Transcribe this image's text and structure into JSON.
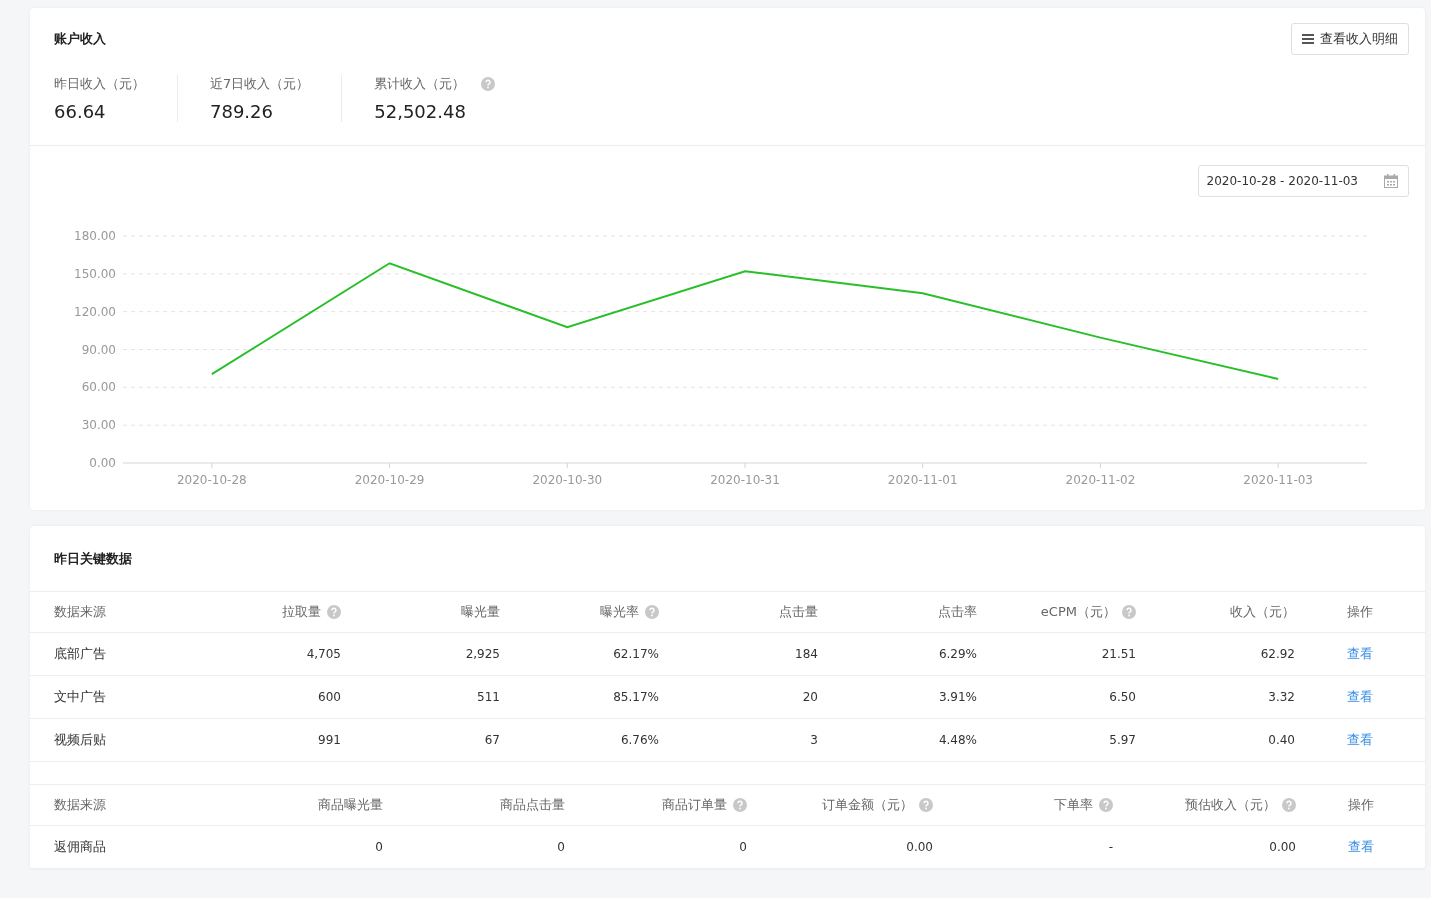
{
  "income_card": {
    "title": "账户收入",
    "detail_button": "查看收入明细",
    "stats": [
      {
        "label": "昨日收入（元）",
        "value": "66.64",
        "help": false
      },
      {
        "label": "近7日收入（元）",
        "value": "789.26",
        "help": false
      },
      {
        "label": "累计收入（元）",
        "value": "52,502.48",
        "help": true
      }
    ],
    "date_range": "2020-10-28 - 2020-11-03",
    "chart_data": {
      "type": "line",
      "categories": [
        "2020-10-28",
        "2020-10-29",
        "2020-10-30",
        "2020-10-31",
        "2020-11-01",
        "2020-11-02",
        "2020-11-03"
      ],
      "series": [
        {
          "color": "#29bf29",
          "values": [
            70.5,
            158.4,
            107.6,
            152.1,
            134.6,
            99.4,
            66.6
          ]
        }
      ],
      "grid": true,
      "ylim": [
        0,
        180
      ],
      "yticks": [
        {
          "value": 0,
          "label": "0.00"
        },
        {
          "value": 30,
          "label": "30.00"
        },
        {
          "value": 60,
          "label": "60.00"
        },
        {
          "value": 90,
          "label": "90.00"
        },
        {
          "value": 120,
          "label": "120.00"
        },
        {
          "value": 150,
          "label": "150.00"
        },
        {
          "value": 180,
          "label": "180.00"
        }
      ]
    }
  },
  "key_data_card": {
    "title": "昨日关键数据",
    "ad_table": {
      "columns": [
        {
          "label": "数据来源",
          "help": false
        },
        {
          "label": "拉取量",
          "help": true
        },
        {
          "label": "曝光量",
          "help": false
        },
        {
          "label": "曝光率",
          "help": true
        },
        {
          "label": "点击量",
          "help": false
        },
        {
          "label": "点击率",
          "help": false
        },
        {
          "label": "eCPM（元）",
          "help": true
        },
        {
          "label": "收入（元）",
          "help": false
        },
        {
          "label": "操作",
          "help": false
        }
      ],
      "rows": [
        {
          "cells": [
            "底部广告",
            "4,705",
            "2,925",
            "62.17%",
            "184",
            "6.29%",
            "21.51",
            "62.92"
          ],
          "action": "查看"
        },
        {
          "cells": [
            "文中广告",
            "600",
            "511",
            "85.17%",
            "20",
            "3.91%",
            "6.50",
            "3.32"
          ],
          "action": "查看"
        },
        {
          "cells": [
            "视频后贴",
            "991",
            "67",
            "6.76%",
            "3",
            "4.48%",
            "5.97",
            "0.40"
          ],
          "action": "查看"
        }
      ]
    },
    "goods_table": {
      "columns": [
        {
          "label": "数据来源",
          "help": false
        },
        {
          "label": "商品曝光量",
          "help": false
        },
        {
          "label": "商品点击量",
          "help": false
        },
        {
          "label": "商品订单量",
          "help": true
        },
        {
          "label": "订单金额（元）",
          "help": true
        },
        {
          "label": "下单率",
          "help": true
        },
        {
          "label": "预估收入（元）",
          "help": true
        },
        {
          "label": "操作",
          "help": false
        }
      ],
      "rows": [
        {
          "cells": [
            "返佣商品",
            "0",
            "0",
            "0",
            "0.00",
            "-",
            "0.00"
          ],
          "action": "查看"
        }
      ]
    }
  }
}
